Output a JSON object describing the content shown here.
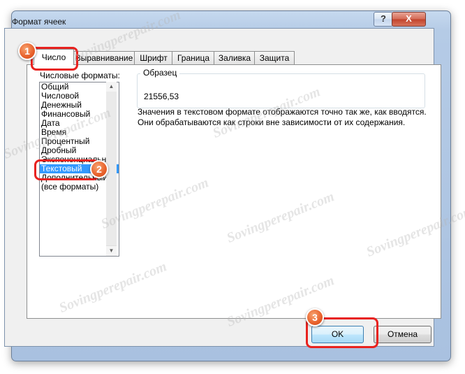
{
  "window": {
    "title": "Формат ячеек",
    "help_label": "?",
    "close_label": "X"
  },
  "tabs": [
    {
      "label": "Число",
      "active": true
    },
    {
      "label": "Выравнивание",
      "active": false
    },
    {
      "label": "Шрифт",
      "active": false
    },
    {
      "label": "Граница",
      "active": false
    },
    {
      "label": "Заливка",
      "active": false
    },
    {
      "label": "Защита",
      "active": false
    }
  ],
  "formats": {
    "label": "Числовые форматы:",
    "items": [
      "Общий",
      "Числовой",
      "Денежный",
      "Финансовый",
      "Дата",
      "Время",
      "Процентный",
      "Дробный",
      "Экспоненциальный",
      "Текстовый",
      "Дополнительный",
      "(все форматы)"
    ],
    "selected": "Текстовый"
  },
  "sample": {
    "legend": "Образец",
    "value": "21556,53"
  },
  "description": "Значения в текстовом формате отображаются точно так же, как вводятся. Они обрабатываются как строки вне зависимости от их содержания.",
  "buttons": {
    "ok": "OK",
    "cancel": "Отмена"
  },
  "callouts": [
    "1",
    "2",
    "3"
  ],
  "watermark": "Sovingperepair.com",
  "colors": {
    "selection": "#3399ff",
    "callout": "#e8221f",
    "badge": "#e8602a"
  }
}
